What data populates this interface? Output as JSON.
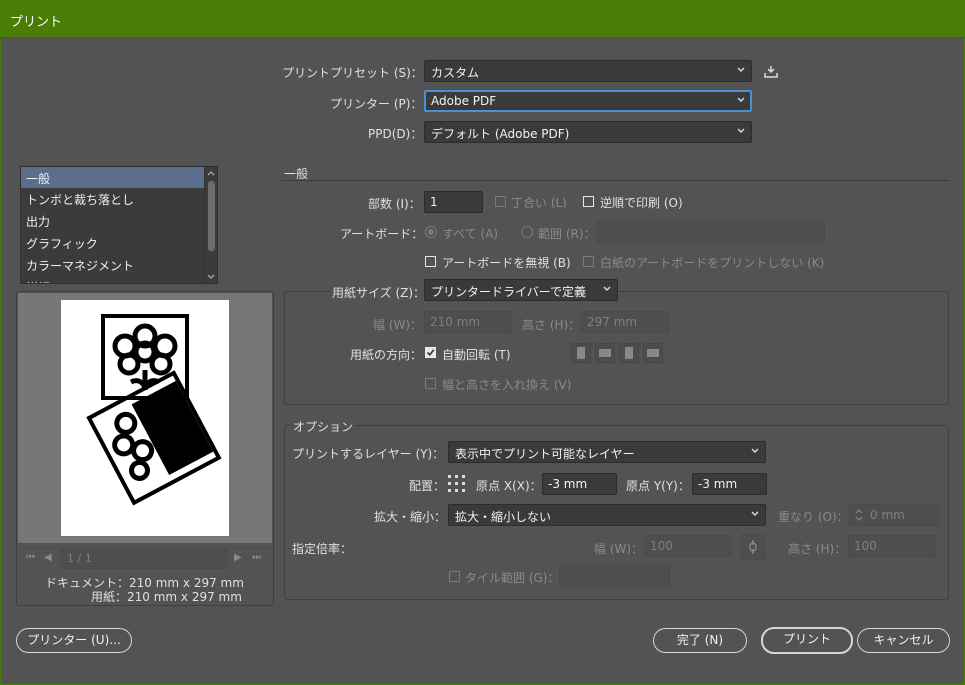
{
  "window": {
    "title": "プリント"
  },
  "top": {
    "preset_label": "プリントプリセット (S)：",
    "preset_value": "カスタム",
    "printer_label": "プリンター (P)：",
    "printer_value": "Adobe PDF",
    "ppd_label": "PPD(D)：",
    "ppd_value": "デフォルト (Adobe PDF)"
  },
  "sidebar": {
    "items": [
      {
        "label": "一般"
      },
      {
        "label": "トンボと裁ち落とし"
      },
      {
        "label": "出力"
      },
      {
        "label": "グラフィック"
      },
      {
        "label": "カラーマネジメント"
      },
      {
        "label": "詳細"
      }
    ]
  },
  "preview": {
    "page_indicator": "1 / 1",
    "document_size": "ドキュメント：210 mm x 297 mm",
    "paper_size": "用紙：210 mm x 297 mm"
  },
  "general": {
    "section_title": "一般",
    "copies_label": "部数 (I)：",
    "copies_value": "1",
    "collate_label": "丁合い (L)",
    "reverse_label": "逆順で印刷 (O)",
    "artboard_label": "アートボード：",
    "all_label": "すべて (A)",
    "range_label": "範囲 (R)：",
    "ignore_artboard_label": "アートボードを無視 (B)",
    "skip_blank_label": "白紙のアートボードをプリントしない (K)",
    "media_size_label": "用紙サイズ (Z)：",
    "media_size_value": "プリンタードライバーで定義",
    "width_label": "幅 (W)：",
    "width_value": "210 mm",
    "height_label": "高さ (H)：",
    "height_value": "297 mm",
    "orientation_label": "用紙の方向：",
    "auto_rotate_label": "自動回転 (T)",
    "transverse_label": "幅と高さを入れ換え (V)"
  },
  "options": {
    "section_title": "オプション",
    "layers_label": "プリントするレイヤー (Y)：",
    "layers_value": "表示中でプリント可能なレイヤー",
    "placement_label": "配置：",
    "origin_x_label": "原点 X(X)：",
    "origin_x_value": "-3 mm",
    "origin_y_label": "原点 Y(Y)：",
    "origin_y_value": "-3 mm",
    "scaling_label": "拡大・縮小：",
    "scaling_value": "拡大・縮小しない",
    "overlap_label": "重なり (O)：",
    "overlap_value": "0 mm",
    "custom_scale_label": "指定倍率：",
    "scale_width_label": "幅 (W)：",
    "scale_width_value": "100",
    "scale_height_label": "高さ (H)：",
    "scale_height_value": "100",
    "tile_range_label": "タイル範囲 (G)："
  },
  "buttons": {
    "printer_setup": "プリンター (U)...",
    "done": "完了 (N)",
    "print": "プリント",
    "cancel": "キャンセル"
  }
}
